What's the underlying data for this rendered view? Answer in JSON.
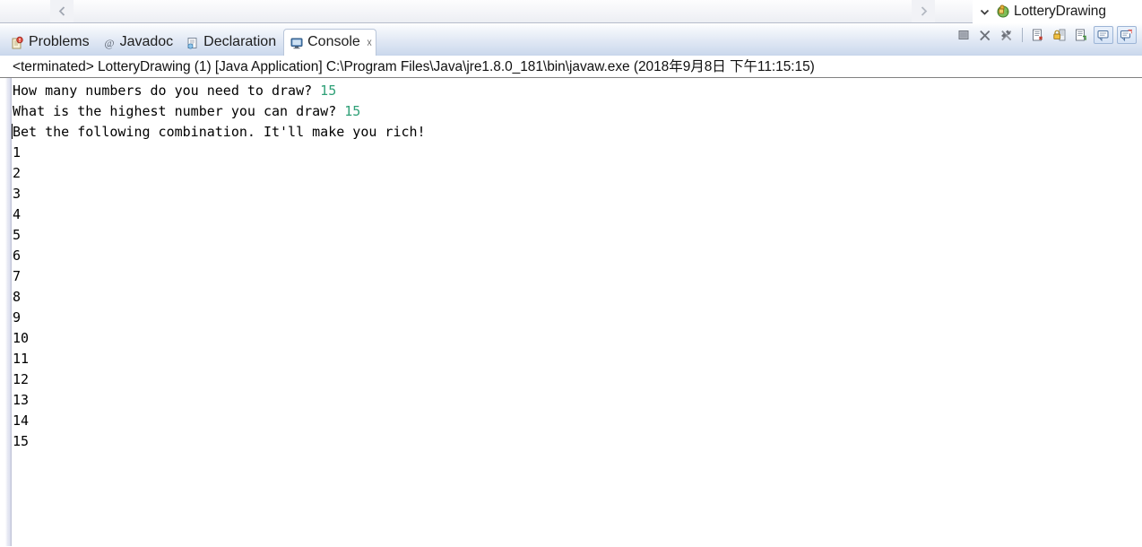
{
  "window": {
    "right_view_tab": {
      "label": "LotteryDrawing",
      "chevron_icon": "chevron-down-icon",
      "icon": "java-debug-icon"
    },
    "editor_scroll": {
      "left_icon": "chevron-left-icon",
      "right_icon": "chevron-right-icon"
    }
  },
  "tabs": [
    {
      "label": "Problems",
      "icon": "problems-icon",
      "active": false,
      "closable": false
    },
    {
      "label": "Javadoc",
      "icon": "javadoc-icon",
      "active": false,
      "closable": false
    },
    {
      "label": "Declaration",
      "icon": "declaration-icon",
      "active": false,
      "closable": false
    },
    {
      "label": "Console",
      "icon": "console-icon",
      "active": true,
      "closable": true,
      "close_glyph": "☓"
    }
  ],
  "toolbar": [
    {
      "name": "terminate-icon",
      "tooltip": "Terminate"
    },
    {
      "name": "remove-launch-icon",
      "tooltip": "Remove Launch"
    },
    {
      "name": "remove-all-launch-icon",
      "tooltip": "Remove All Terminated Launches"
    },
    {
      "name": "clear-console-icon",
      "tooltip": "Clear Console"
    },
    {
      "name": "scroll-lock-icon",
      "tooltip": "Scroll Lock"
    },
    {
      "name": "word-wrap-icon",
      "tooltip": "Word Wrap"
    },
    {
      "name": "display-console-icon",
      "tooltip": "Display Selected Console"
    },
    {
      "name": "open-console-icon",
      "tooltip": "Open Console"
    }
  ],
  "console": {
    "header": "<terminated> LotteryDrawing (1) [Java Application] C:\\Program Files\\Java\\jre1.8.0_181\\bin\\javaw.exe (2018年9月8日 下午11:15:15)",
    "prompt_1": "How many numbers do you need to draw? ",
    "input_1": "15",
    "prompt_2": "What is the highest number you can draw? ",
    "input_2": "15",
    "message": "Bet the following combination. It'll make you rich!",
    "numbers": [
      "1",
      "2",
      "3",
      "4",
      "5",
      "6",
      "7",
      "8",
      "9",
      "10",
      "11",
      "12",
      "13",
      "14",
      "15"
    ]
  },
  "colors": {
    "input_green": "#2fa077",
    "tabbar_blue": "#ccd9ed",
    "text_black": "#000000",
    "console_bg": "#ffffff"
  }
}
